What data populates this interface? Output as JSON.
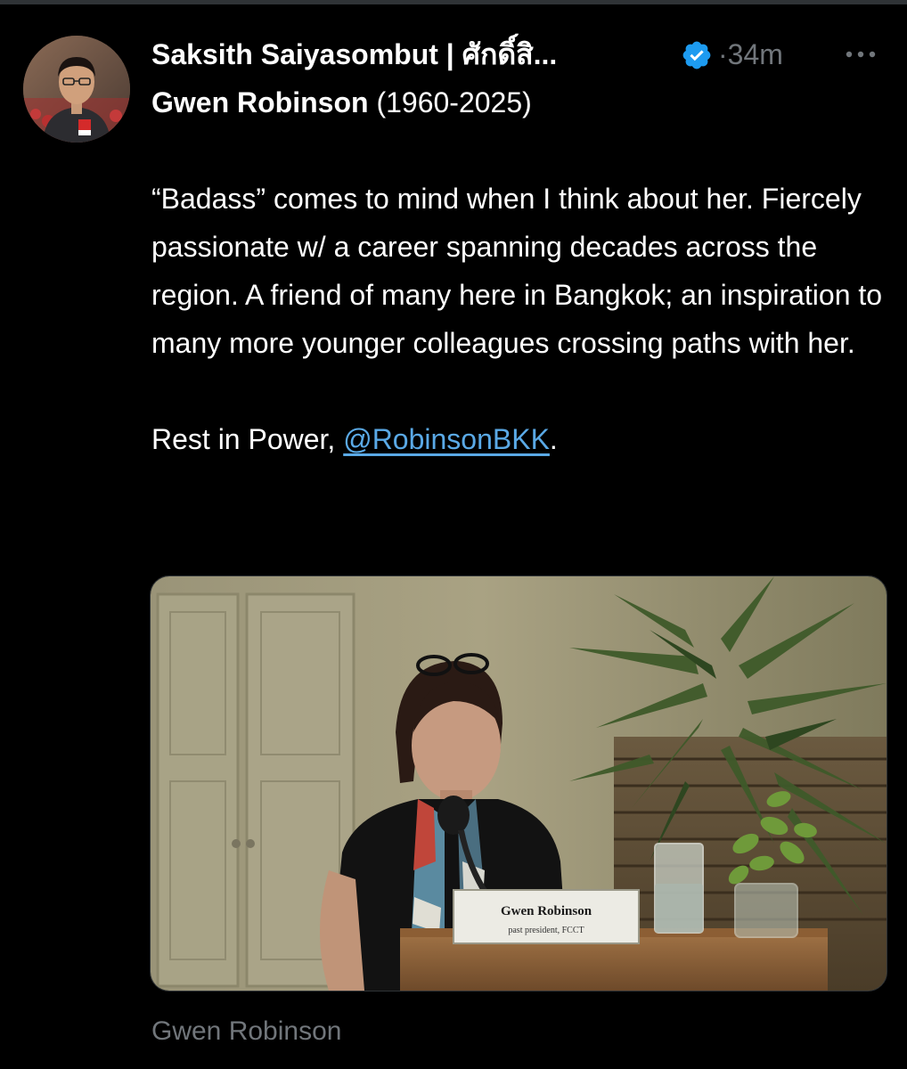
{
  "post": {
    "author": {
      "display_name": "Saksith Saiyasombut | ศักดิ์สิ...",
      "verified": true,
      "verified_icon": "verified-badge-icon",
      "avatar_icon": "profile-photo"
    },
    "separator": "·",
    "timestamp": "34m",
    "more_icon": "more-horizontal-icon",
    "title_name": "Gwen Robinson",
    "title_years": " (1960-2025)",
    "body_paragraph": "“Badass” comes to mind when I think about her. Fiercely passionate w/ a career spanning decades across the region. A friend of many here in Bangkok; an inspiration to many more younger colleagues crossing paths with her.",
    "closing_prefix": "Rest in Power, ",
    "mention": "@RobinsonBKK",
    "closing_suffix": ".",
    "media": {
      "nameplate_name": "Gwen Robinson",
      "nameplate_title": "past president, FCCT"
    },
    "media_caption": "Gwen Robinson"
  },
  "colors": {
    "background": "#000000",
    "text": "#ffffff",
    "secondary_text": "#71767b",
    "link": "#5aa9e6",
    "verified": "#1d9bf0"
  }
}
